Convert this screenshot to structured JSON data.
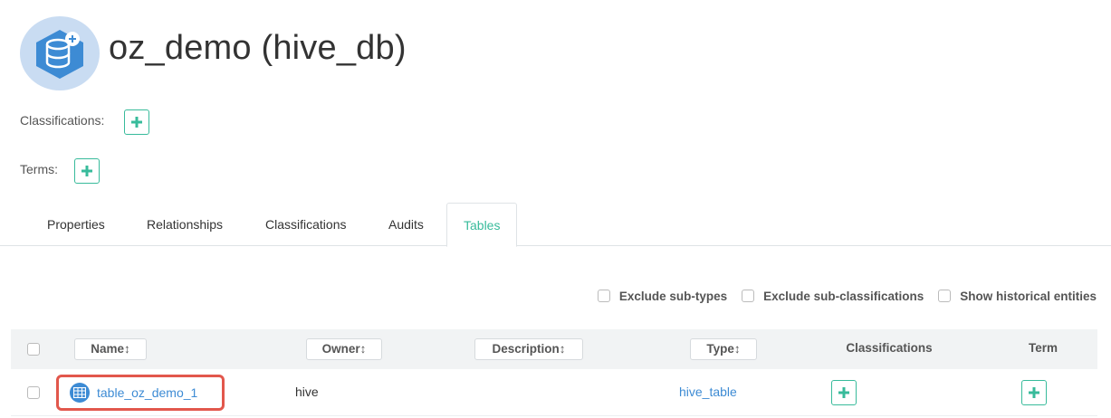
{
  "header": {
    "title": "oz_demo (hive_db)"
  },
  "meta": {
    "classifications_label": "Classifications:",
    "terms_label": "Terms:"
  },
  "tabs": [
    {
      "label": "Properties"
    },
    {
      "label": "Relationships"
    },
    {
      "label": "Classifications"
    },
    {
      "label": "Audits"
    },
    {
      "label": "Tables",
      "active": true
    }
  ],
  "filters": [
    {
      "label": "Exclude sub-types",
      "checked": false
    },
    {
      "label": "Exclude sub-classifications",
      "checked": false
    },
    {
      "label": "Show historical entities",
      "checked": false
    }
  ],
  "table": {
    "columns": [
      "Name↕",
      "Owner↕",
      "Description↕",
      "Type↕",
      "Classifications",
      "Term"
    ],
    "rows": [
      {
        "name": "table_oz_demo_1",
        "owner": "hive",
        "description": "",
        "type": "hive_table"
      }
    ]
  },
  "colors": {
    "accent_green": "#38bb9b",
    "link_blue": "#3d8bd4",
    "highlight_red": "#e2574c"
  }
}
